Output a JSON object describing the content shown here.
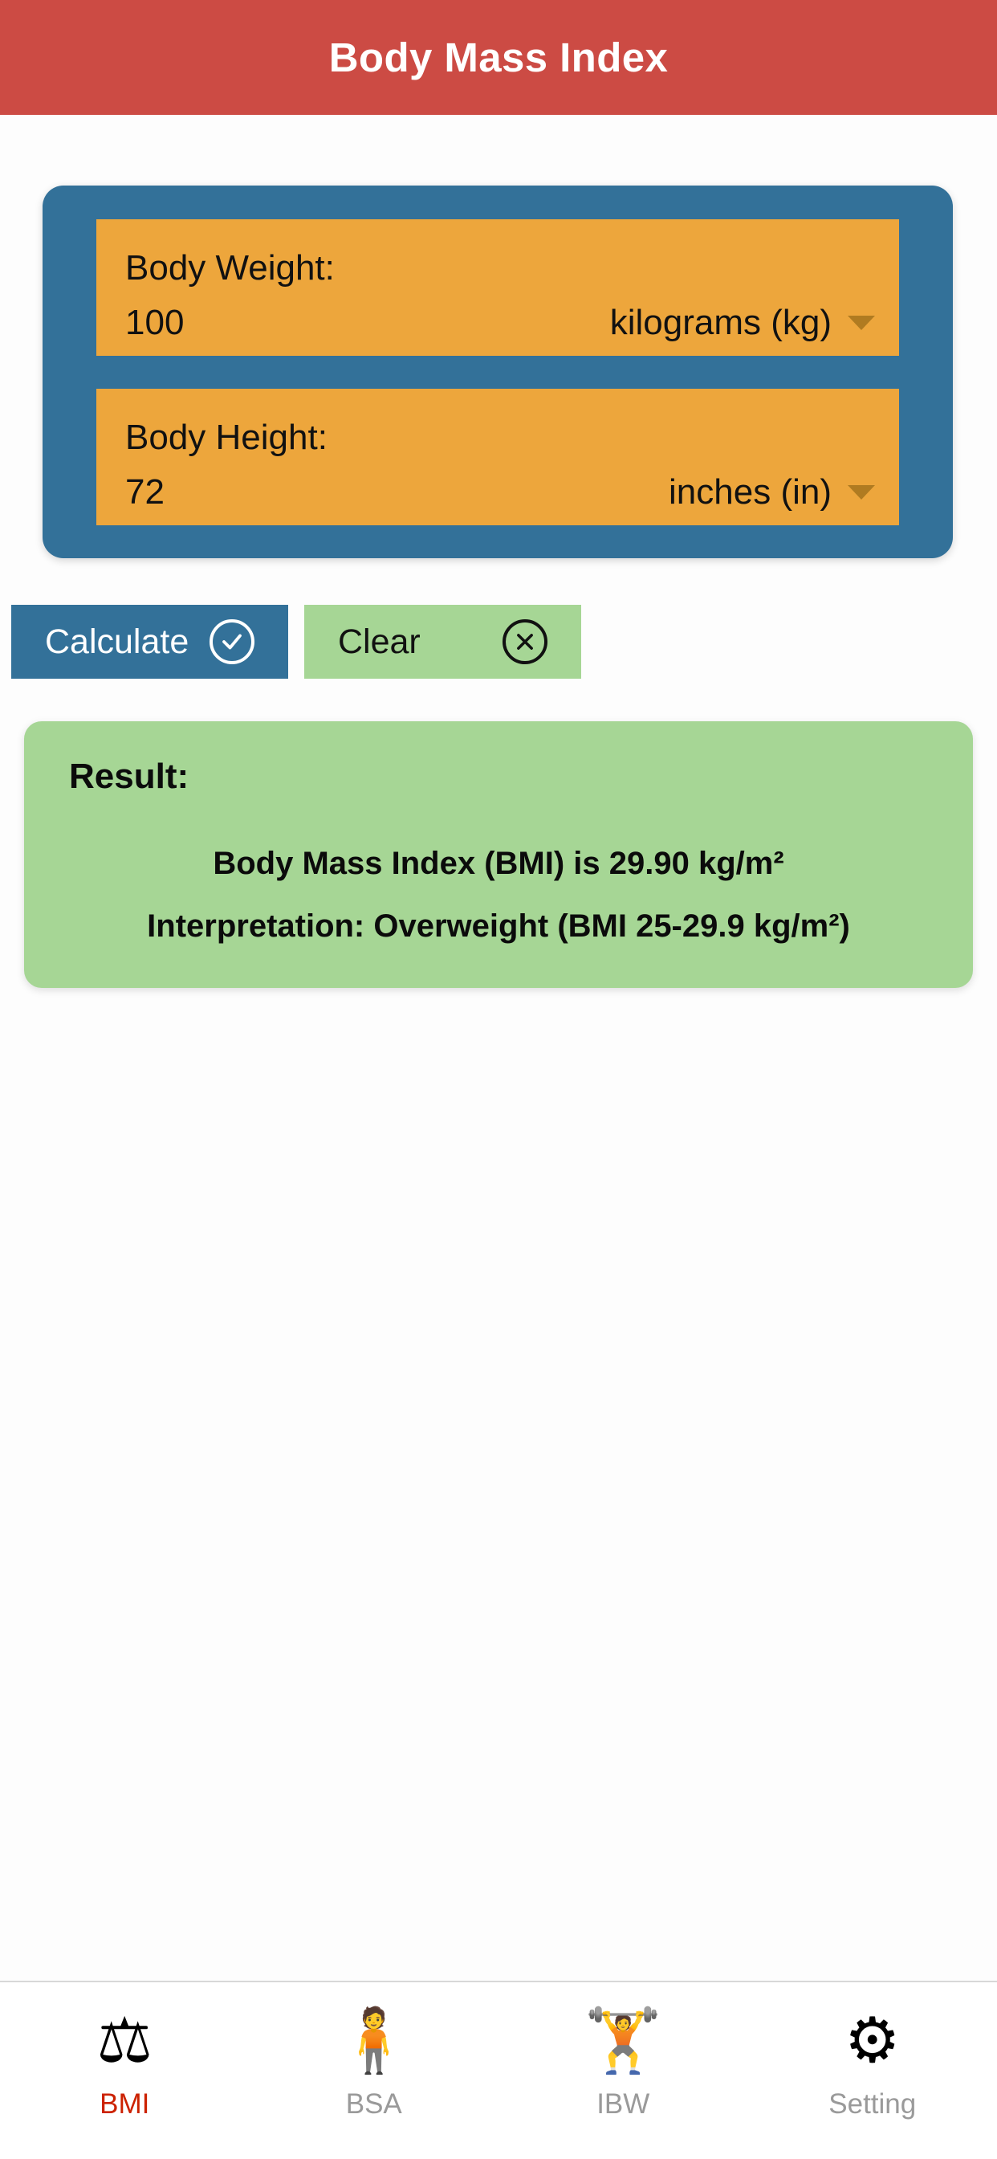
{
  "header": {
    "title": "Body Mass Index",
    "background_color": "#cc4b44"
  },
  "input_card": {
    "background_color": "#337199",
    "panel_color": "#eda63c",
    "weight": {
      "label": "Body Weight:",
      "value": "100",
      "unit": "kilograms (kg)",
      "caret_icon": "chevron-down-icon"
    },
    "height": {
      "label": "Body Height:",
      "value": "72",
      "unit": "inches (in)",
      "caret_icon": "chevron-down-icon"
    }
  },
  "actions": {
    "calculate": {
      "label": "Calculate",
      "icon": "check-circle-icon",
      "background_color": "#337199",
      "text_color": "#ffffff"
    },
    "clear": {
      "label": "Clear",
      "icon": "x-circle-icon",
      "background_color": "#a6d695",
      "text_color": "#111111"
    }
  },
  "result": {
    "background_color": "#a6d695",
    "title": "Result:",
    "bmi_line": "Body Mass Index (BMI) is 29.90 kg/m²",
    "interpretation_line": "Interpretation: Overweight (BMI 25-29.9 kg/m²)",
    "bmi_value": "29.90",
    "bmi_unit": "kg/m²",
    "category": "Overweight",
    "category_range": "BMI 25-29.9 kg/m²"
  },
  "tabbar": {
    "active_color": "#cc2200",
    "inactive_color": "#9a9a9a",
    "items": [
      {
        "label": "BMI",
        "icon": "bathroom-scale-icon",
        "glyph": "⚖",
        "active": true
      },
      {
        "label": "BSA",
        "icon": "torso-body-icon",
        "glyph": "🧍",
        "active": false
      },
      {
        "label": "IBW",
        "icon": "person-lifting-weights-icon",
        "glyph": "🏋",
        "active": false
      },
      {
        "label": "Setting",
        "icon": "gear-icon",
        "glyph": "⚙",
        "active": false
      }
    ]
  }
}
